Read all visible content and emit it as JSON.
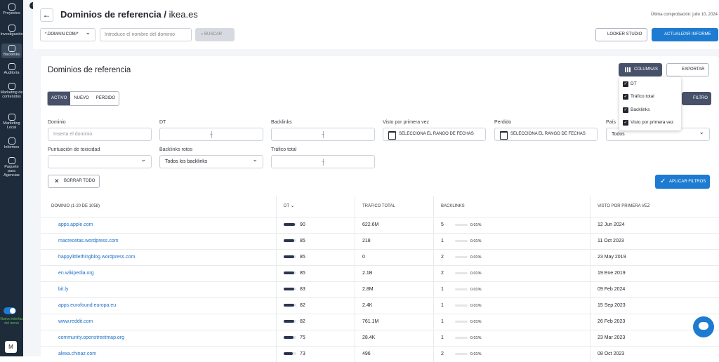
{
  "sidebar": {
    "items": [
      {
        "label": "Proyectos",
        "icon": "home-icon"
      },
      {
        "label": "Investigación",
        "icon": "research-icon"
      },
      {
        "label": "Backlinks",
        "icon": "link-icon",
        "active": true
      },
      {
        "label": "Auditoría",
        "icon": "audit-icon"
      },
      {
        "label": "Marketing de contenidos",
        "icon": "content-icon"
      },
      {
        "label": "Marketing Local",
        "icon": "location-icon"
      },
      {
        "label": "Informes",
        "icon": "reports-icon"
      },
      {
        "label": "Paquete para Agencias",
        "icon": "agency-icon"
      }
    ],
    "toggle_label": "Nuevo interfaz del menú",
    "avatar": "M"
  },
  "header": {
    "title": "Dominios de referencia / ",
    "domain": "ikea.es",
    "last_check": "Última comprobación: julio 10, 2024",
    "domain_select": "*.DOMAIN.COM/*",
    "search_placeholder": "Introduce el nombre del dominio",
    "search_button": "BUSCAR",
    "looker_button": "LOOKER STUDIO",
    "update_button": "ACTUALIZAR INFORME"
  },
  "panel": {
    "title": "Dominios de referencia",
    "columns_button": "COLUMNAS",
    "export_button": "EXPORTAR",
    "filter_button": "FILTRO",
    "column_options": [
      "DT",
      "Tráfico total",
      "Backlinks",
      "Visto por primera vez"
    ],
    "segments": [
      "ACTIVO",
      "NUEVO",
      "PERDIDO"
    ]
  },
  "filters": {
    "domain_label": "Dominio",
    "domain_placeholder": "Inserta el dominio",
    "dt_label": "DT",
    "backlinks_label": "Backlinks",
    "first_seen_label": "Visto por primera vez",
    "first_seen_value": "SELECCIONA EL RANGO DE FECHAS",
    "lost_label": "Perdido",
    "lost_value": "SELECCIONA EL RANGO DE FECHAS",
    "country_label": "País",
    "country_value": "Todos",
    "toxicity_label": "Puntuación de toxicidad",
    "broken_label": "Backlinks rotos",
    "broken_value": "Todos los backlinks",
    "traffic_label": "Tráfico total",
    "clear_button": "BORRAR TODO",
    "apply_button": "APLICAR FILTROS"
  },
  "table": {
    "headers": [
      "DOMINIO (1-20 DE 1058)",
      "DT",
      "TRÁFICO TOTAL",
      "BACKLINKS",
      "VISTO POR PRIMERA VEZ"
    ],
    "rows": [
      {
        "domain": "apps.apple.com",
        "dt": "90",
        "traffic": "622.6M",
        "backlinks": "5",
        "pct": "0.01%",
        "first_seen": "12 Jun 2024"
      },
      {
        "domain": "macrecetas.wordpress.com",
        "dt": "85",
        "traffic": "218",
        "backlinks": "1",
        "pct": "0.01%",
        "first_seen": "11 Oct 2023"
      },
      {
        "domain": "happylittlethingblog.wordpress.com",
        "dt": "85",
        "traffic": "0",
        "backlinks": "2",
        "pct": "0.01%",
        "first_seen": "23 May 2019"
      },
      {
        "domain": "en.wikipedia.org",
        "dt": "85",
        "traffic": "2.1B",
        "backlinks": "2",
        "pct": "0.01%",
        "first_seen": "19 Ene 2019"
      },
      {
        "domain": "bit.ly",
        "dt": "83",
        "traffic": "2.8M",
        "backlinks": "1",
        "pct": "0.01%",
        "first_seen": "09 Feb 2024"
      },
      {
        "domain": "apps.eurofound.europa.eu",
        "dt": "82",
        "traffic": "2.4K",
        "backlinks": "1",
        "pct": "0.01%",
        "first_seen": "15 Sep 2023"
      },
      {
        "domain": "www.reddit.com",
        "dt": "82",
        "traffic": "761.1M",
        "backlinks": "1",
        "pct": "0.01%",
        "first_seen": "26 Feb 2023"
      },
      {
        "domain": "community.openstreetmap.org",
        "dt": "75",
        "traffic": "28.4K",
        "backlinks": "1",
        "pct": "0.01%",
        "first_seen": "23 Mar 2023"
      },
      {
        "domain": "alexa.chinaz.com",
        "dt": "73",
        "traffic": "496",
        "backlinks": "2",
        "pct": "0.01%",
        "first_seen": "08 Oct 2023"
      }
    ]
  },
  "colors": {
    "accent": "#1d7bd1",
    "sidebar": "#1d2b3a",
    "dark_button": "#48516a"
  }
}
